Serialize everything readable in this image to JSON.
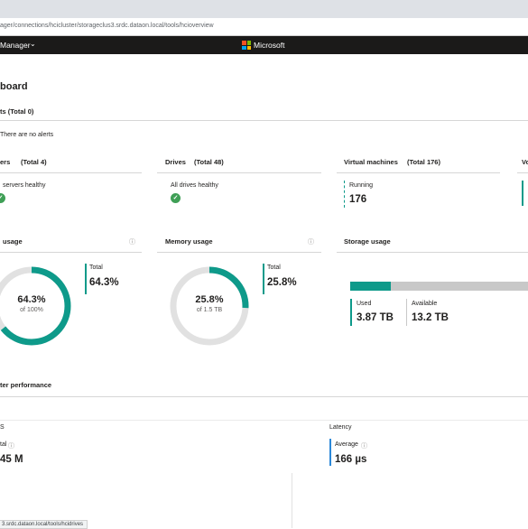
{
  "browser": {
    "url": "ager/connections/hcicluster/storageclus3.srdc.dataon.local/tools/hcioverview"
  },
  "app": {
    "title": "Manager",
    "brand": "Microsoft"
  },
  "page": {
    "title": "board",
    "alerts_heading": "ts (Total 0)",
    "alerts_text": "There are no alerts"
  },
  "tiles": {
    "servers": {
      "label": "ers",
      "total": "(Total 4)",
      "status": "servers healthy"
    },
    "drives": {
      "label": "Drives",
      "total": "(Total 48)",
      "status": "All drives healthy"
    },
    "vms": {
      "label": "Virtual machines",
      "total": "(Total 176)",
      "sub": "Running",
      "value": "176"
    },
    "volumes": {
      "label": "Vo"
    }
  },
  "usage": {
    "cpu": {
      "title": "usage",
      "center_value": "64.3%",
      "center_sub": "of 100%",
      "side_label": "Total",
      "side_value": "64.3%",
      "fraction": 0.643
    },
    "memory": {
      "title": "Memory usage",
      "center_value": "25.8%",
      "center_sub": "of 1.5 TB",
      "side_label": "Total",
      "side_value": "25.8%",
      "fraction": 0.258
    },
    "storage": {
      "title": "Storage usage",
      "used_label": "Used",
      "used_value": "3.87 TB",
      "available_label": "Available",
      "available_value": "13.2 TB",
      "fraction": 0.227
    }
  },
  "performance": {
    "title": "ter performance",
    "iops_head": "S",
    "iops_label": "tal",
    "iops_value": "45 M",
    "latency_head": "Latency",
    "latency_label": "Average",
    "latency_value": "166 µs"
  },
  "statusbar": {
    "url": "3.srdc.dataon.local/tools/hcidrives"
  },
  "colors": {
    "accent": "#0e9a8a",
    "track": "#e1e1e1",
    "ok": "#3f9f56"
  }
}
